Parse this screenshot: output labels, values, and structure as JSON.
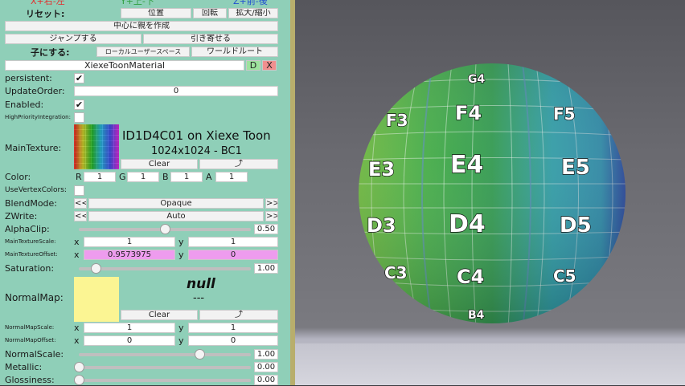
{
  "top_hint": {
    "left": "X+右-左",
    "center": "Y+上-下",
    "right": "Z+前-後"
  },
  "toolbar": {
    "reset": "リセット:",
    "position": "位置",
    "rotation": "回転",
    "scale": "拡大/縮小"
  },
  "create_parent_at_center": "中心に親を作成",
  "jump": "ジャンプする",
  "pull_closer": "引き寄せる",
  "make_child": {
    "label": "子にする:",
    "local_user_space": "ローカルユーザースペース",
    "world_root": "ワールドルート"
  },
  "component": {
    "name": "XiexeToonMaterial",
    "d_button": "D",
    "x_button": "X"
  },
  "persistent": {
    "label": "persistent:",
    "checked": "✔"
  },
  "update_order": {
    "label": "UpdateOrder:",
    "value": "0"
  },
  "enabled": {
    "label": "Enabled:",
    "checked": "✔"
  },
  "high_priority": {
    "label": "HighPriorityIntegration:"
  },
  "main_texture": {
    "label": "MainTexture:",
    "name": "ID1D4C01 on Xiexe Toon",
    "info": "1024x1024 - BC1",
    "clear": "Clear",
    "pick": "⤴"
  },
  "color": {
    "label": "Color:",
    "r_label": "R",
    "r": "1",
    "g_label": "G",
    "g": "1",
    "b_label": "B",
    "b": "1",
    "a_label": "A",
    "a": "1"
  },
  "use_vertex_colors": {
    "label": "UseVertexColors:"
  },
  "blend_mode": {
    "label": "BlendMode:",
    "value": "Opaque",
    "prev": "<<",
    "next": ">>"
  },
  "zwrite": {
    "label": "ZWrite:",
    "value": "Auto",
    "prev": "<<",
    "next": ">>"
  },
  "alpha_clip": {
    "label": "AlphaClip:",
    "value": "0.50",
    "level": 0.5
  },
  "main_texture_scale": {
    "label": "MainTextureScale:",
    "x_label": "x",
    "x": "1",
    "y_label": "y",
    "y": "1"
  },
  "main_texture_offset": {
    "label": "MainTextureOffset:",
    "x_label": "x",
    "x": "0.9573975",
    "y_label": "y",
    "y": "0"
  },
  "saturation": {
    "label": "Saturation:",
    "value": "1.00",
    "level": 0.1
  },
  "normal_map": {
    "label": "NormalMap:",
    "name": "null",
    "info": "---",
    "clear": "Clear",
    "pick": "⤴"
  },
  "normal_map_scale": {
    "label": "NormalMapScale:",
    "x_label": "x",
    "x": "1",
    "y_label": "y",
    "y": "1"
  },
  "normal_map_offset": {
    "label": "NormalMapOffset:",
    "x_label": "x",
    "x": "0",
    "y_label": "y",
    "y": "0"
  },
  "normal_scale": {
    "label": "NormalScale:",
    "value": "1.00",
    "level": 0.7
  },
  "metallic": {
    "label": "Metallic:",
    "value": "0.00",
    "level": 0.0
  },
  "glossiness": {
    "label": "Glossiness:",
    "value": "0.00",
    "level": 0.0
  },
  "sphere": {
    "labels": [
      "G4",
      "F3",
      "F4",
      "F5",
      "E3",
      "E4",
      "E5",
      "D3",
      "D4",
      "D5",
      "C3",
      "C4",
      "C5",
      "B4"
    ],
    "colors": {
      "left": "#3aa84a",
      "center": "#2f9a4e",
      "right": "#31a7b2",
      "far_right": "#3b62c4"
    }
  },
  "colors": {
    "panel": "#8fcfb8",
    "border": "#b8ae6c",
    "pink_field": "#ee9cee",
    "normal_swatch": "#fbf593"
  }
}
